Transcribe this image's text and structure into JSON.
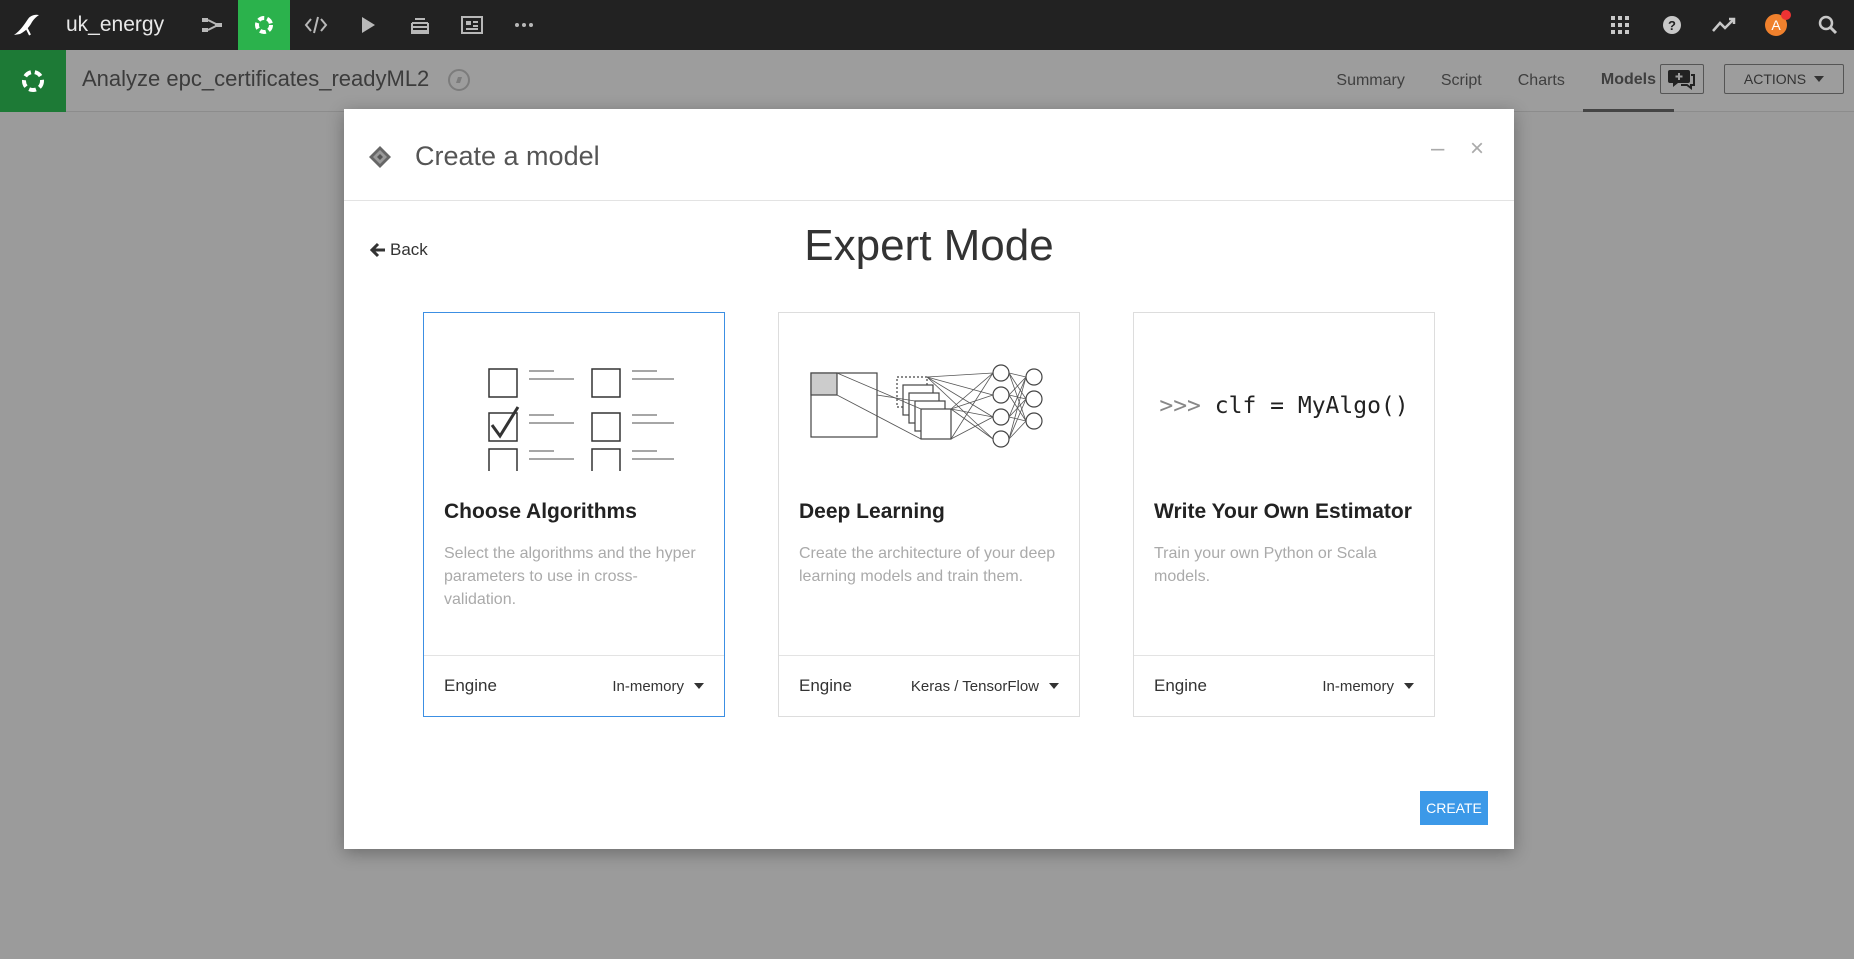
{
  "topnav": {
    "project_name": "uk_energy",
    "avatar_letter": "A",
    "accent_color": "#2bb24c"
  },
  "subbar": {
    "title": "Analyze epc_certificates_readyML2",
    "tabs": [
      "Summary",
      "Script",
      "Charts",
      "Models"
    ],
    "active_tab": "Models",
    "actions_label": "ACTIONS"
  },
  "modal": {
    "title": "Create a model",
    "back_label": "Back",
    "mode_title": "Expert Mode",
    "cards": [
      {
        "title": "Choose Algorithms",
        "description": "Select the algorithms and the hyper parameters to use in cross-validation.",
        "engine_label": "Engine",
        "engine_value": "In-memory",
        "icon": "checklist-icon",
        "selected": true
      },
      {
        "title": "Deep Learning",
        "description": "Create the architecture of your deep learning models and train them.",
        "engine_label": "Engine",
        "engine_value": "Keras / TensorFlow",
        "icon": "neural-network-icon",
        "selected": false
      },
      {
        "title": "Write Your Own Estimator",
        "description": "Train your own Python or Scala models.",
        "engine_label": "Engine",
        "engine_value": "In-memory",
        "code_prompt": ">>>",
        "code_text": "clf = MyAlgo()",
        "selected": false
      }
    ],
    "create_label": "CREATE",
    "create_color": "#3c99e8",
    "selected_border_color": "#3c8fe3"
  }
}
